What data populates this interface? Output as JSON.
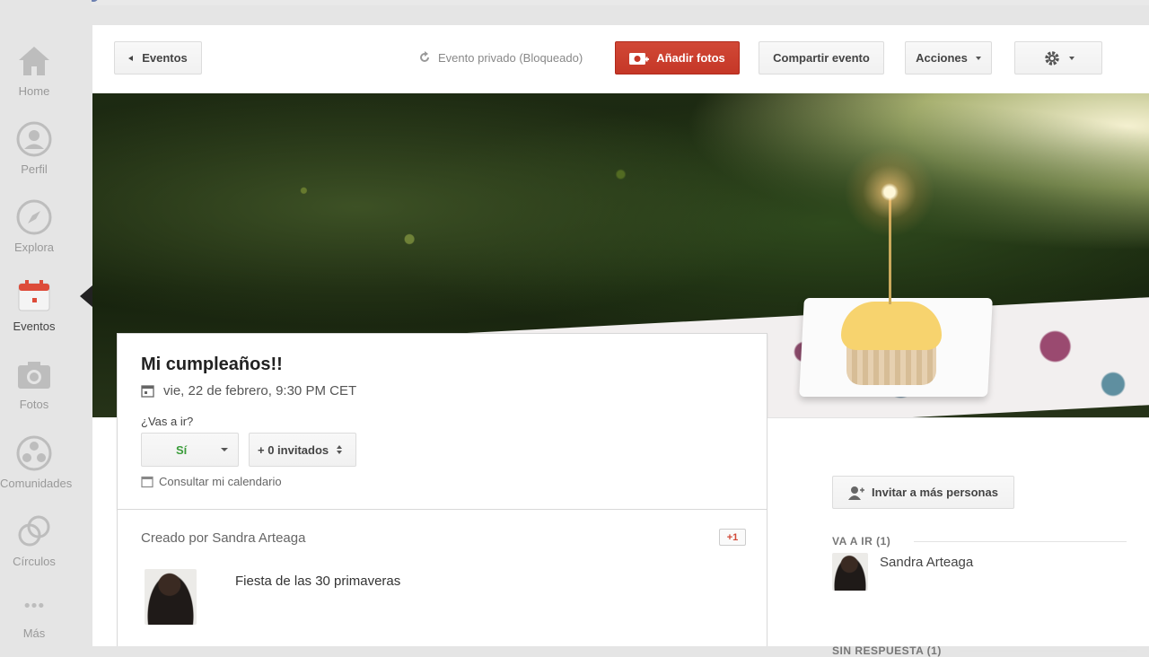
{
  "sidebar": {
    "items": [
      {
        "label": "Home",
        "icon": "home-icon"
      },
      {
        "label": "Perfil",
        "icon": "profile-icon"
      },
      {
        "label": "Explora",
        "icon": "compass-icon"
      },
      {
        "label": "Eventos",
        "icon": "calendar-icon",
        "active": true
      },
      {
        "label": "Fotos",
        "icon": "camera-icon"
      },
      {
        "label": "Comunidades",
        "icon": "communities-icon"
      },
      {
        "label": "Círculos",
        "icon": "circles-icon"
      },
      {
        "label": "Más",
        "icon": "more-icon"
      }
    ]
  },
  "toolbar": {
    "back_label": "Eventos",
    "privacy_text": "Evento privado (Bloqueado)",
    "add_photos_label": "Añadir fotos",
    "share_label": "Compartir evento",
    "actions_label": "Acciones"
  },
  "event": {
    "title": "Mi cumpleaños!!",
    "date": "vie, 22 de febrero, 9:30 PM CET",
    "question": "¿Vas a ir?",
    "rsvp_value": "Sí",
    "guests_value": "+ 0 invitados",
    "calendar_link": "Consultar mi calendario"
  },
  "creator": {
    "header": "Creado por Sandra Arteaga",
    "plus_one": "+1",
    "description": "Fiesta de las 30 primaveras"
  },
  "attendees": {
    "invite_label": "Invitar a más personas",
    "going_title": "VA A IR (1)",
    "going": [
      {
        "name": "Sandra Arteaga"
      }
    ],
    "no_response_title": "SIN RESPUESTA (1)"
  },
  "colors": {
    "accent_red": "#d14836",
    "yes_green": "#3a9c3a"
  }
}
